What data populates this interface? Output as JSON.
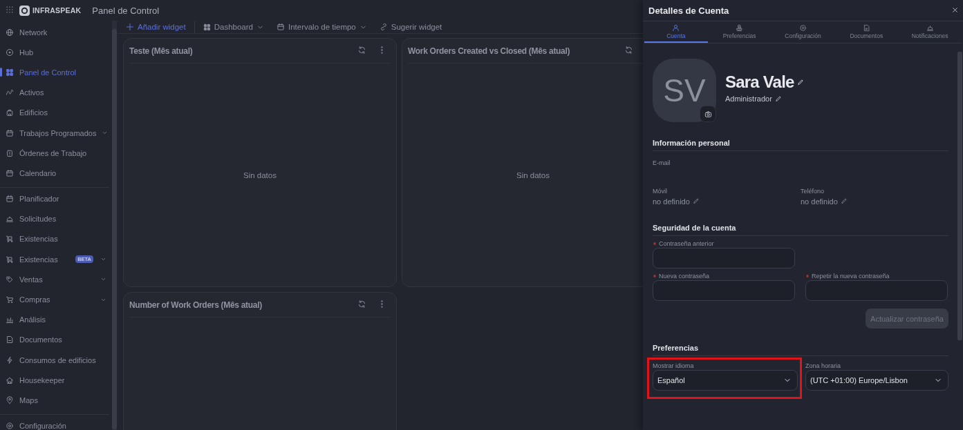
{
  "app": {
    "brand": "INFRASPEAK",
    "page_title": "Panel de Control"
  },
  "sidebar": {
    "groups": [
      {
        "items": [
          {
            "label": "Network",
            "selected": false,
            "expandable": false
          },
          {
            "label": "Hub",
            "selected": false,
            "expandable": false
          },
          {
            "label": "Panel de Control",
            "selected": true,
            "expandable": false
          },
          {
            "label": "Activos",
            "selected": false,
            "expandable": false
          },
          {
            "label": "Edificios",
            "selected": false,
            "expandable": false
          },
          {
            "label": "Trabajos Programados",
            "selected": false,
            "expandable": true
          },
          {
            "label": "Órdenes de Trabajo",
            "selected": false,
            "expandable": false
          },
          {
            "label": "Calendario",
            "selected": false,
            "expandable": false
          }
        ]
      },
      {
        "items": [
          {
            "label": "Planificador",
            "selected": false,
            "expandable": false
          },
          {
            "label": "Solicitudes",
            "selected": false,
            "expandable": false
          },
          {
            "label": "Existencias",
            "selected": false,
            "expandable": false
          },
          {
            "label": "Existencias",
            "selected": false,
            "expandable": true,
            "badge": "BETA"
          },
          {
            "label": "Ventas",
            "selected": false,
            "expandable": true
          },
          {
            "label": "Compras",
            "selected": false,
            "expandable": true
          },
          {
            "label": "Análisis",
            "selected": false,
            "expandable": false
          },
          {
            "label": "Documentos",
            "selected": false,
            "expandable": false
          },
          {
            "label": "Consumos de edificios",
            "selected": false,
            "expandable": false
          },
          {
            "label": "Housekeeper",
            "selected": false,
            "expandable": false
          },
          {
            "label": "Maps",
            "selected": false,
            "expandable": false
          }
        ]
      },
      {
        "items": [
          {
            "label": "Configuración",
            "selected": false,
            "expandable": false
          }
        ]
      }
    ]
  },
  "toolbar": {
    "items": [
      {
        "kind": "add",
        "label": "Añadir widget"
      },
      {
        "kind": "dashboard",
        "label": "Dashboard"
      },
      {
        "kind": "range",
        "label": "Intervalo de tiempo"
      },
      {
        "kind": "suggest",
        "label": "Sugerir widget"
      }
    ]
  },
  "widgets": [
    {
      "title": "Teste (Mês atual)",
      "empty_text": "Sin datos"
    },
    {
      "title": "Work Orders Created vs Closed (Mês atual)",
      "empty_text": "Sin datos"
    },
    {
      "title": "Number of Work Orders (Mês atual)"
    }
  ],
  "drawer": {
    "title": "Detalles de Cuenta",
    "tabs": [
      {
        "label": "Cuenta",
        "selected": true
      },
      {
        "label": "Preferencias",
        "selected": false
      },
      {
        "label": "Configuración",
        "selected": false
      },
      {
        "label": "Documentos",
        "selected": false
      },
      {
        "label": "Notificaciones",
        "selected": false
      }
    ],
    "profile": {
      "initials": "SV",
      "name": "Sara Vale",
      "role": "Administrador"
    },
    "personal_info": {
      "heading": "Información personal",
      "fields": [
        {
          "label": "E-mail"
        },
        {
          "label": "Móvil",
          "value": "no definido"
        },
        {
          "label": "Teléfono",
          "value": "no definido"
        }
      ]
    },
    "security": {
      "heading": "Seguridad de la cuenta",
      "fields": [
        {
          "label": "Contraseña anterior",
          "required": true
        },
        {
          "label": "Nueva contraseña",
          "required": true
        },
        {
          "label": "Repetir la nueva contraseña",
          "required": true
        }
      ],
      "button": {
        "label": "Actualizar contraseña",
        "disabled": true
      }
    },
    "preferences": {
      "heading": "Preferencias",
      "fields": [
        {
          "label": "Mostrar idioma",
          "value": "Español",
          "highlighted": true
        },
        {
          "label": "Zona horaria",
          "value": "(UTC +01:00) Europe/Lisbon",
          "highlighted": false
        }
      ]
    }
  }
}
